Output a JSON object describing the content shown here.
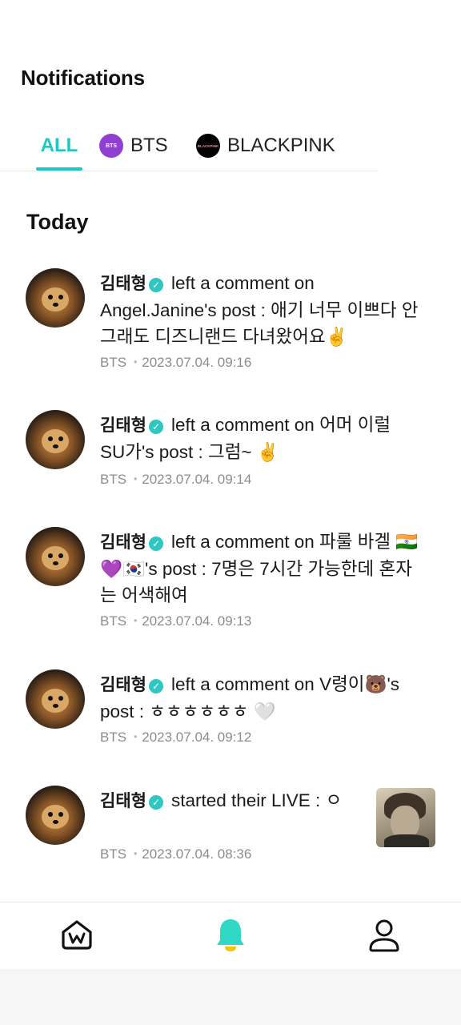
{
  "header": {
    "title": "Notifications"
  },
  "tabs": [
    {
      "label": "ALL",
      "active": true
    },
    {
      "label": "BTS",
      "logo_text": "BTS"
    },
    {
      "label": "BLACKPINK",
      "logo_text": "BLACKPINK"
    }
  ],
  "section": {
    "title": "Today"
  },
  "notifications": [
    {
      "author": "김태형",
      "action": "left a comment on",
      "body": "Angel.Janine's post : 애기 너무 이쁘다 안그래도 디즈니랜드 다녀왔어요✌️",
      "source": "BTS",
      "time": "2023.07.04. 09:16"
    },
    {
      "author": "김태형",
      "action": "left a comment on",
      "body": "어머 이럴 SU가's post : 그럼~ ✌️",
      "source": "BTS",
      "time": "2023.07.04. 09:14"
    },
    {
      "author": "김태형",
      "action": "left a comment on",
      "body": "파룰 바겔 🇮🇳💜🇰🇷's post : 7명은 7시간 가능한데 혼자는 어색해여",
      "source": "BTS",
      "time": "2023.07.04. 09:13"
    },
    {
      "author": "김태형",
      "action": "left a comment on",
      "body": "V령이🐻's post : ㅎㅎㅎㅎㅎㅎ 🤍",
      "source": "BTS",
      "time": "2023.07.04. 09:12"
    },
    {
      "author": "김태형",
      "action": "started their LIVE :",
      "body": "ㅇ",
      "source": "BTS",
      "time": "2023.07.04. 08:36"
    }
  ],
  "icons": {
    "home": "weverse-home-icon",
    "notifications": "bell-icon",
    "profile": "person-icon",
    "verified": "verified-badge-icon"
  },
  "colors": {
    "accent": "#1cc8bf",
    "verified": "#2ec7c1",
    "bts": "#8f3fd1",
    "meta": "#8c8c8c"
  }
}
